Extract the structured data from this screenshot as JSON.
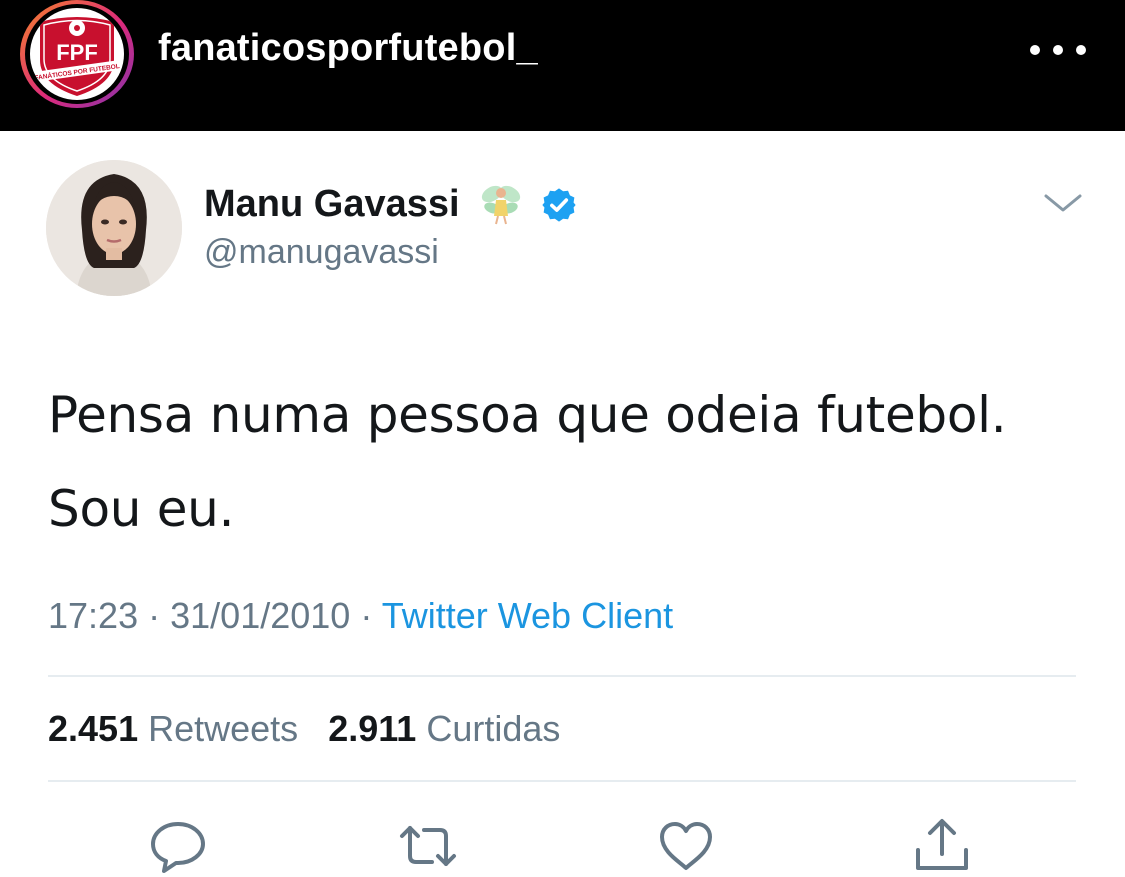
{
  "instagram": {
    "username": "fanaticosporfutebol_",
    "avatar_logo_text": "FPF",
    "avatar_logo_subtext": "FANÁTICOS POR FUTEBOL",
    "more_icon": "more-horizontal-icon"
  },
  "tweet": {
    "display_name": "Manu Gavassi",
    "handle": "@manugavassi",
    "name_emoji": "fairy",
    "verified": true,
    "text_lines": [
      "Pensa numa pessoa que odeia futebol.",
      "Sou eu."
    ],
    "time": "17:23",
    "date": "31/01/2010",
    "separator": "·",
    "source": "Twitter Web Client",
    "retweets_count": "2.451",
    "retweets_label": "Retweets",
    "likes_count": "2.911",
    "likes_label": "Curtidas",
    "actions": [
      "reply-icon",
      "retweet-icon",
      "like-icon",
      "share-icon"
    ]
  },
  "colors": {
    "header_bg": "#000000",
    "text_primary": "#14171a",
    "text_secondary": "#657786",
    "link_blue": "#1b95e0",
    "verified_blue": "#1da1f2",
    "logo_red": "#c8102e"
  }
}
